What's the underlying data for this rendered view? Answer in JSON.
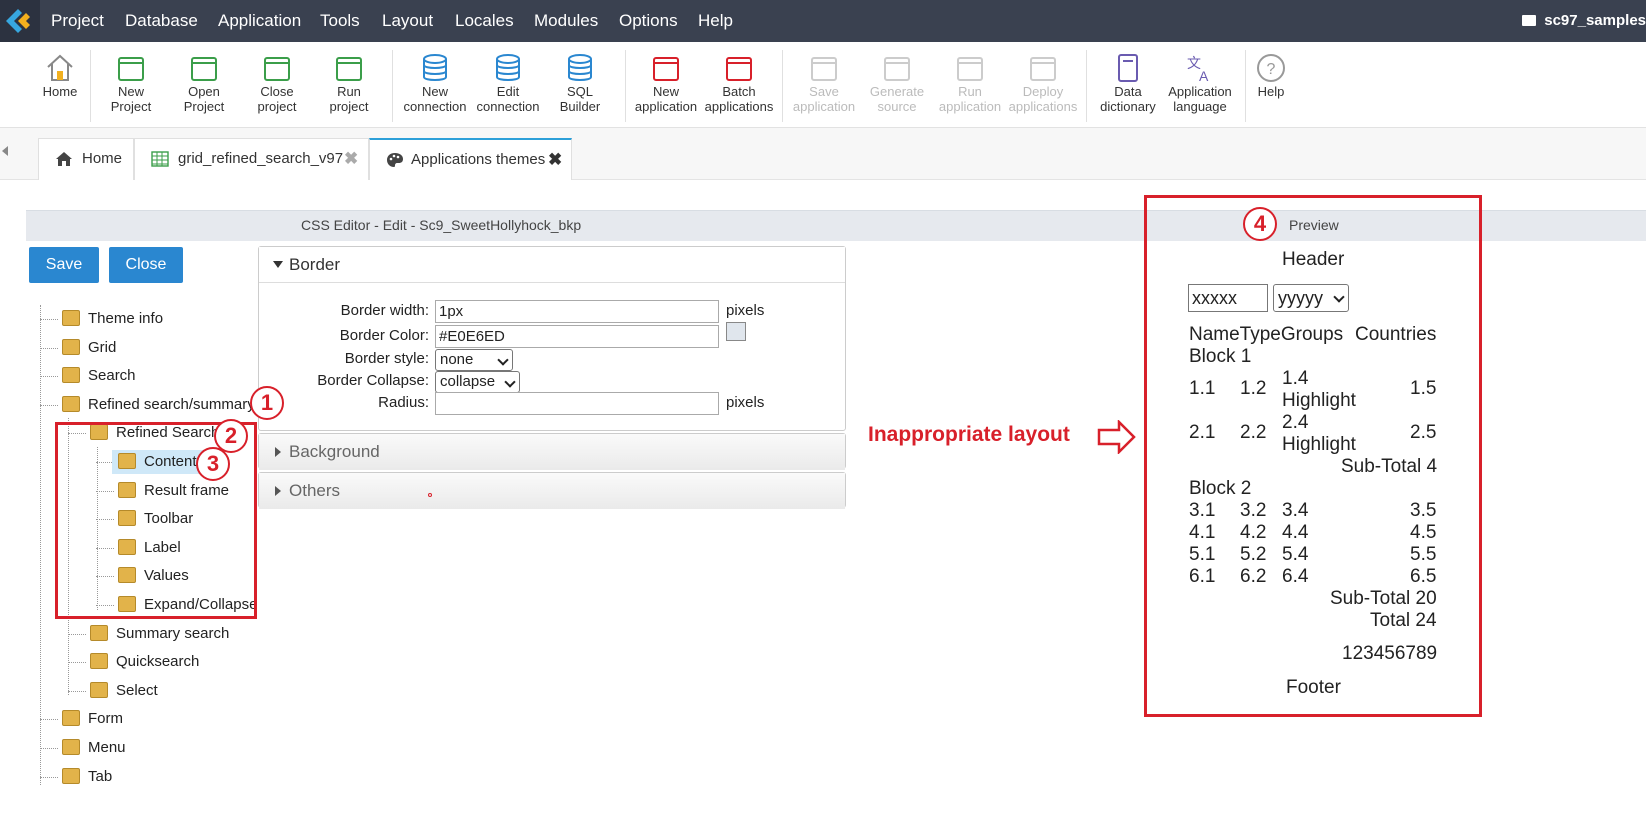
{
  "menu": {
    "items": [
      "Project",
      "Database",
      "Application",
      "Tools",
      "Layout",
      "Locales",
      "Modules",
      "Options",
      "Help"
    ],
    "project_name": "sc97_samples"
  },
  "toolbar": {
    "buttons": [
      {
        "label": "Home",
        "icon": "home-icon"
      },
      {
        "label": "New\nProject",
        "icon": "new-project-icon"
      },
      {
        "label": "Open\nProject",
        "icon": "open-project-icon"
      },
      {
        "label": "Close\nproject",
        "icon": "close-project-icon"
      },
      {
        "label": "Run\nproject",
        "icon": "run-project-icon"
      },
      {
        "label": "New\nconnection",
        "icon": "new-connection-icon"
      },
      {
        "label": "Edit\nconnection",
        "icon": "edit-connection-icon"
      },
      {
        "label": "SQL\nBuilder",
        "icon": "sql-builder-icon"
      },
      {
        "label": "New\napplication",
        "icon": "new-application-icon"
      },
      {
        "label": "Batch\napplications",
        "icon": "batch-applications-icon"
      },
      {
        "label": "Save\napplication",
        "icon": "save-application-icon",
        "disabled": true
      },
      {
        "label": "Generate\nsource",
        "icon": "generate-source-icon",
        "disabled": true
      },
      {
        "label": "Run\napplication",
        "icon": "run-application-icon",
        "disabled": true
      },
      {
        "label": "Deploy\napplications",
        "icon": "deploy-applications-icon",
        "disabled": true
      },
      {
        "label": "Data\ndictionary",
        "icon": "data-dictionary-icon"
      },
      {
        "label": "Application\nlanguage",
        "icon": "application-language-icon"
      },
      {
        "label": "Help",
        "icon": "help-icon"
      }
    ]
  },
  "tabs": [
    {
      "label": "Home",
      "icon": "home-icon"
    },
    {
      "label": "grid_refined_search_v97",
      "icon": "grid-icon"
    },
    {
      "label": "Applications themes",
      "icon": "palette-icon"
    }
  ],
  "editor": {
    "title": "CSS Editor - Edit - Sc9_SweetHollyhock_bkp",
    "preview_title": "Preview",
    "save_label": "Save",
    "close_label": "Close"
  },
  "tree": [
    "Theme info",
    "Grid",
    "Search",
    "Refined search/summary",
    "Refined Search",
    "Content",
    "Result frame",
    "Toolbar",
    "Label",
    "Values",
    "Expand/Collapse",
    "Summary search",
    "Quicksearch",
    "Select",
    "Form",
    "Menu",
    "Tab"
  ],
  "border_panel": {
    "title": "Border",
    "width_label": "Border width:",
    "width_value": "1px",
    "width_unit": "pixels",
    "color_label": "Border Color:",
    "color_value": "#E0E6ED",
    "style_label": "Border style:",
    "style_value": "none",
    "collapse_label": "Border Collapse:",
    "collapse_value": "collapse",
    "radius_label": "Radius:",
    "radius_value": "",
    "radius_unit": "pixels"
  },
  "background_panel": {
    "title": "Background"
  },
  "others_panel": {
    "title": "Others"
  },
  "annotation": {
    "text": "Inappropriate layout",
    "markers": [
      "1",
      "2",
      "3",
      "4"
    ]
  },
  "preview": {
    "header": "Header",
    "input1": "xxxxx",
    "select1": "yyyyy",
    "col_headers": "NameTypeGroups",
    "col_countries": "Countries",
    "block1": "Block 1",
    "row1": [
      "1.1",
      "1.2",
      "1.4",
      "Highlight",
      "1.5"
    ],
    "row2": [
      "2.1",
      "2.2",
      "2.4",
      "Highlight",
      "2.5"
    ],
    "subtotal1": "Sub-Total 4",
    "block2": "Block 2",
    "rows": [
      [
        "3.1",
        "3.2",
        "3.4",
        "3.5"
      ],
      [
        "4.1",
        "4.2",
        "4.4",
        "4.5"
      ],
      [
        "5.1",
        "5.2",
        "5.4",
        "5.5"
      ],
      [
        "6.1",
        "6.2",
        "6.4",
        "6.5"
      ]
    ],
    "subtotal2": "Sub-Total 20",
    "total": "Total 24",
    "number": "123456789",
    "footer": "Footer"
  },
  "colors": {
    "accent": "#2a87d0",
    "annotation": "#d8202a",
    "menubar": "#3a4150"
  }
}
